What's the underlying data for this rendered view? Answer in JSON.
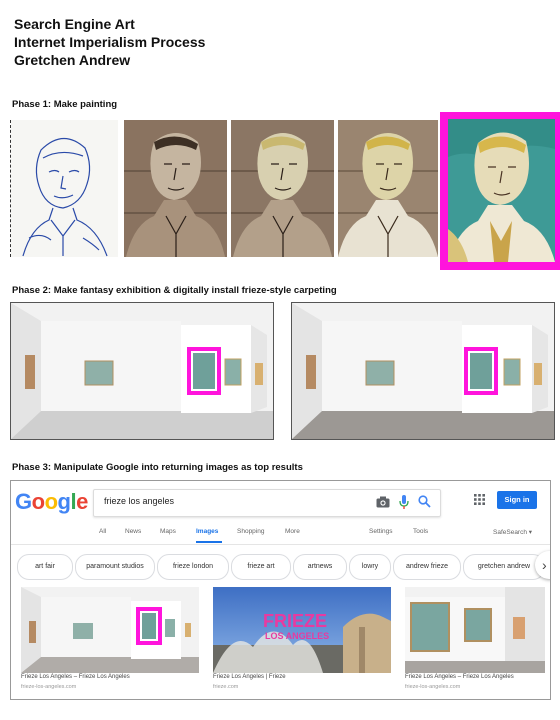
{
  "header": {
    "line1": "Search Engine Art",
    "line2": "Internet Imperialism Process",
    "line3": "Gretchen Andrew"
  },
  "phases": {
    "phase1": "Phase 1: Make painting",
    "phase2": "Phase 2: Make fantasy exhibition & digitally install frieze-style carpeting",
    "phase3": "Phase 3: Manipulate Google into returning images as top results"
  },
  "colors": {
    "highlight": "#ff14dc",
    "google_blue": "#1a73e8"
  },
  "google": {
    "logo": "Google",
    "query": "frieze los angeles",
    "signin_label": "Sign in",
    "tabs": [
      "All",
      "News",
      "Maps",
      "Images",
      "Shopping",
      "More",
      "Settings",
      "Tools",
      "SafeSearch ▾"
    ],
    "active_tab": "Images",
    "chips": [
      "art fair",
      "paramount studios",
      "frieze london",
      "frieze art",
      "artnews",
      "lowry",
      "andrew frieze",
      "gretchen andrew"
    ],
    "results": [
      {
        "title": "Frieze Los Angeles – Frieze Los Angeles",
        "source": "frieze-los-angeles.com"
      },
      {
        "title": "Frieze Los Angeles | Frieze",
        "source": "frieze.com"
      },
      {
        "title": "Frieze Los Angeles – Frieze Los Angeles",
        "source": "frieze-los-angeles.com"
      }
    ],
    "banner_word": "FRIEZE",
    "banner_sub": "LOS ANGELES",
    "icons": [
      "camera-icon",
      "microphone-icon",
      "search-icon",
      "apps-grid-icon",
      "chevron-right-icon"
    ]
  }
}
